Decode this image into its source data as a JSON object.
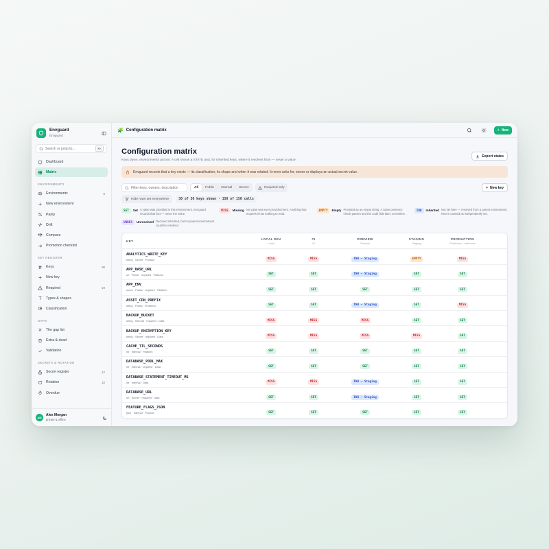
{
  "app": {
    "name": "Envguard",
    "sub": "Envguard"
  },
  "search": {
    "placeholder": "Search or jump to...",
    "shortcut": "⌘K"
  },
  "nav_top": [
    {
      "label": "Dashboard",
      "icon": "shield-icon",
      "active": false
    },
    {
      "label": "Matrix",
      "icon": "grid-icon",
      "active": true
    }
  ],
  "sections": [
    {
      "title": "ENVIRONMENTS",
      "items": [
        {
          "label": "Environments",
          "count": "5",
          "icon": "layers-icon"
        },
        {
          "label": "New environment",
          "count": "",
          "icon": "plus-icon"
        },
        {
          "label": "Parity",
          "count": "",
          "icon": "percent-icon"
        },
        {
          "label": "Drift",
          "count": "",
          "icon": "activity-icon"
        },
        {
          "label": "Compare",
          "count": "",
          "icon": "scale-icon"
        },
        {
          "label": "Promotion checklist",
          "count": "",
          "icon": "arrow-right-icon"
        }
      ]
    },
    {
      "title": "KEY REGISTER",
      "items": [
        {
          "label": "Keys",
          "count": "30",
          "icon": "hash-icon"
        },
        {
          "label": "New key",
          "count": "",
          "icon": "plus-icon"
        },
        {
          "label": "Required",
          "count": "19",
          "icon": "alert-triangle-icon"
        },
        {
          "label": "Types & shapes",
          "count": "",
          "icon": "type-icon"
        },
        {
          "label": "Classification",
          "count": "",
          "icon": "pie-icon"
        }
      ]
    },
    {
      "title": "GAPS",
      "items": [
        {
          "label": "The gap list",
          "count": "",
          "icon": "x-icon"
        },
        {
          "label": "Extra & dead",
          "count": "",
          "icon": "trash-icon"
        },
        {
          "label": "Validation",
          "count": "",
          "icon": "check-icon"
        }
      ]
    },
    {
      "title": "SECRETS & ROTATION",
      "items": [
        {
          "label": "Secret register",
          "count": "12",
          "icon": "lock-icon"
        },
        {
          "label": "Rotation",
          "count": "10",
          "icon": "rotate-icon"
        },
        {
          "label": "Overdue",
          "count": "",
          "icon": "flame-icon"
        }
      ]
    }
  ],
  "user": {
    "initials": "AM",
    "name": "Alex Morgan",
    "sub": "private & offline"
  },
  "topbar": {
    "title": "Configuration matrix",
    "new_label": "New"
  },
  "page": {
    "title": "Configuration matrix",
    "subtitle": "Keys down, environments across. A cell shows a STATE and, for inherited keys, where it resolves from — never a value.",
    "export_label": "Export states",
    "notice": "Envguard records that a key exists — its classification, its shape and when it was rotated. It never asks for, stores or displays an actual secret value."
  },
  "filters": {
    "placeholder": "Filter keys, owners, description",
    "segments": [
      "All",
      "Public",
      "Internal",
      "Secret"
    ],
    "active_segment": "All",
    "required_only": "Required only",
    "new_key": "New key",
    "hide_rows": "Hide rows set everywhere",
    "shown": "30 of 30 keys shown · 150 of 150 cells"
  },
  "legend": [
    {
      "badge": "SET",
      "cls": "b-set",
      "name": "Set",
      "desc": "A value was provided in this environment. Envguard records that fact — never the value."
    },
    {
      "badge": "MISS",
      "cls": "b-miss",
      "name": "Missing",
      "desc": "No value was ever provided here. Anything that requires it has nothing to read."
    },
    {
      "badge": "EMPTY",
      "cls": "b-empty",
      "name": "Empty",
      "desc": "Provided as an empty string. A naive presence check passes and the code fails later, at runtime."
    },
    {
      "badge": "INH",
      "cls": "b-inh",
      "name": "Inherited",
      "desc": "Not set here — resolved from a parent environment. Never counted as independently set."
    },
    {
      "badge": "UNRES",
      "cls": "b-unres",
      "name": "Unresolved",
      "desc": "Declared inherited, but no parent environment could be resolved."
    }
  ],
  "table": {
    "key_header": "KEY",
    "envs": [
      {
        "name": "LOCAL DEV",
        "sub": "Local"
      },
      {
        "name": "CI",
        "sub": "CI"
      },
      {
        "name": "PREVIEW",
        "sub": "Preview"
      },
      {
        "name": "STAGING",
        "sub": "Staging"
      },
      {
        "name": "PRODUCTION",
        "sub": "Production · reference"
      }
    ],
    "rows": [
      {
        "key": "ANALYTICS_WRITE_KEY",
        "meta": "string · Secret · Product",
        "cells": [
          "MISS",
          "MISS",
          "INH → Staging",
          "EMPTY",
          "MISS"
        ]
      },
      {
        "key": "APP_BASE_URL",
        "meta": "url · Public · required · Platform",
        "cells": [
          "SET",
          "SET",
          "INH → Staging",
          "SET",
          "SET"
        ]
      },
      {
        "key": "APP_ENV",
        "meta": "enum · Public · required · Platform",
        "cells": [
          "SET",
          "SET",
          "SET",
          "SET",
          "SET"
        ]
      },
      {
        "key": "ASSET_CDN_PREFIX",
        "meta": "string · Public · Frontend",
        "cells": [
          "SET",
          "SET",
          "INH → Staging",
          "SET",
          "MISS"
        ]
      },
      {
        "key": "BACKUP_BUCKET",
        "meta": "string · Internal · required · Data",
        "cells": [
          "MISS",
          "MISS",
          "MISS",
          "SET",
          "SET"
        ]
      },
      {
        "key": "BACKUP_ENCRYPTION_KEY",
        "meta": "string · Secret · required · Data",
        "cells": [
          "MISS",
          "MISS",
          "MISS",
          "MISS",
          "SET"
        ]
      },
      {
        "key": "CACHE_TTL_SECONDS",
        "meta": "int · Internal · Platform",
        "cells": [
          "SET",
          "SET",
          "SET",
          "SET",
          "SET"
        ]
      },
      {
        "key": "DATABASE_POOL_MAX",
        "meta": "int · Internal · required · Data",
        "cells": [
          "SET",
          "SET",
          "SET",
          "SET",
          "SET"
        ]
      },
      {
        "key": "DATABASE_STATEMENT_TIMEOUT_MS",
        "meta": "int · Internal · Data",
        "cells": [
          "MISS",
          "MISS",
          "INH → Staging",
          "SET",
          "SET"
        ]
      },
      {
        "key": "DATABASE_URL",
        "meta": "url · Secret · required · Data",
        "cells": [
          "SET",
          "SET",
          "INH → Staging",
          "SET",
          "SET"
        ]
      },
      {
        "key": "FEATURE_FLAGS_JSON",
        "meta": "json · Internal · Product",
        "cells": [
          "SET",
          "SET",
          "SET",
          "SET",
          "SET"
        ]
      }
    ]
  },
  "colors": {
    "accent": "#16b37a",
    "set": "#13824f",
    "miss": "#c0262d",
    "empty": "#b65c10",
    "inh": "#2c55c6",
    "unres": "#6d3fc7"
  }
}
